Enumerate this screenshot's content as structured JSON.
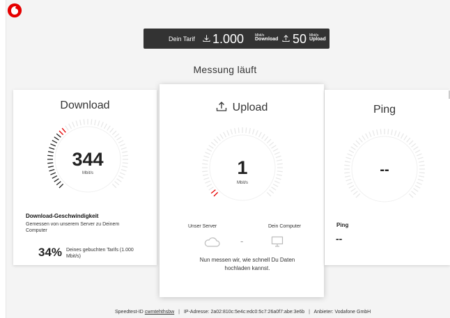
{
  "tarif": {
    "label": "Dein Tarif",
    "download_value": "1.000",
    "download_unit": "Mbit/s",
    "download_caption": "Download",
    "upload_value": "50",
    "upload_unit": "Mbit/s",
    "upload_caption": "Upload"
  },
  "status": "Messung läuft",
  "download": {
    "title": "Download",
    "value": "344",
    "unit": "Mbit/s",
    "level": 0.344,
    "sub_title": "Download-Geschwindigkeit",
    "sub_text": "Gemessen von unserem Server zu Deinem Computer",
    "percent": "34%",
    "percent_text": "Deines gebuchten Tarifs (1.000 Mbit/s)"
  },
  "upload": {
    "title": "Upload",
    "value": "1",
    "unit": "Mbit/s",
    "level": 0.02,
    "server_label": "Unser Server",
    "computer_label": "Dein Computer",
    "dash": "-",
    "message": "Nun messen wir, wie schnell Du Daten hochladen kannst."
  },
  "ping": {
    "title": "Ping",
    "value": "--",
    "label": "Ping",
    "result": "--"
  },
  "footer": {
    "speedtest_label": "Speedtest-ID",
    "speedtest_id": "cwmtehthsbw",
    "ip_label": "IP-Adresse:",
    "ip_value": "2a02:810c:5e4c:edc0:5c7:26a0f7:abe:3e6b",
    "provider_label": "Anbieter:",
    "provider_value": "Vodafone GmbH"
  },
  "colors": {
    "brand": "#e60000",
    "dark": "#333333"
  }
}
